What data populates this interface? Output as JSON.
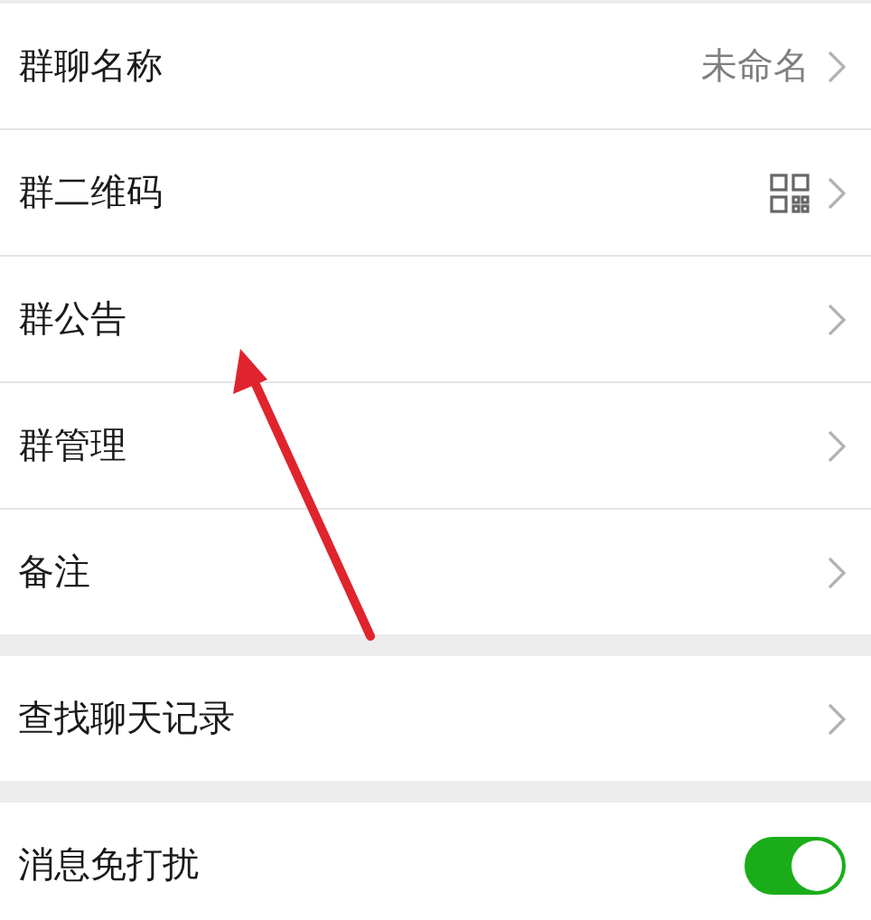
{
  "groups": [
    {
      "rows": [
        {
          "kind": "value",
          "label": "群聊名称",
          "value": "未命名"
        },
        {
          "kind": "qr",
          "label": "群二维码"
        },
        {
          "kind": "plain",
          "label": "群公告"
        },
        {
          "kind": "plain",
          "label": "群管理"
        },
        {
          "kind": "plain",
          "label": "备注"
        }
      ]
    },
    {
      "rows": [
        {
          "kind": "plain",
          "label": "查找聊天记录"
        }
      ]
    },
    {
      "rows": [
        {
          "kind": "toggle",
          "label": "消息免打扰",
          "on": true
        }
      ]
    }
  ]
}
